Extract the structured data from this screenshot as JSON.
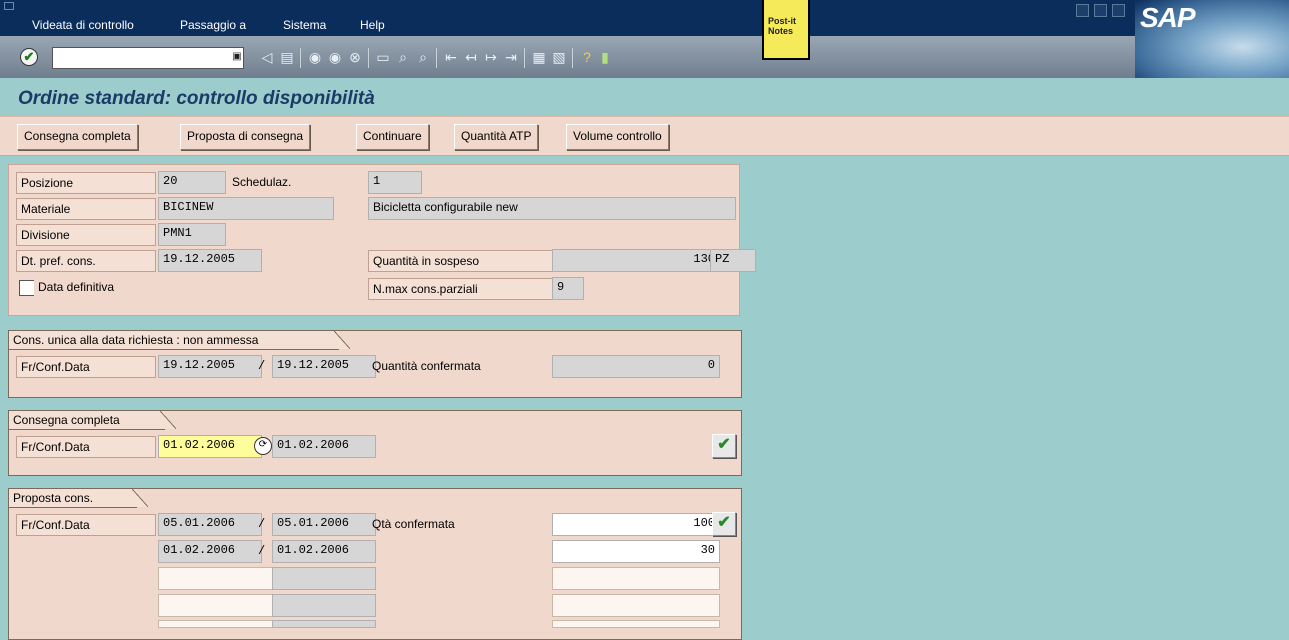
{
  "menu": {
    "items": [
      "Videata di controllo",
      "Passaggio a",
      "Sistema",
      "Help"
    ]
  },
  "branding": {
    "logo": "SAP",
    "postit_label": "Post-it Notes"
  },
  "toolbar": {
    "command_field_value": "",
    "icons": [
      "enter-icon",
      "back-icon",
      "save-icon",
      "green-back-icon",
      "exit-icon",
      "cancel-icon",
      "print-icon",
      "find-icon",
      "find-next-icon",
      "first-page-icon",
      "prev-page-icon",
      "next-page-icon",
      "last-page-icon",
      "create-session-icon",
      "shortcut-icon",
      "help-icon",
      "layout-icon"
    ]
  },
  "page": {
    "title": "Ordine standard: controllo disponibilità"
  },
  "app_toolbar": {
    "buttons": [
      "Consegna completa",
      "Proposta di consegna",
      "Continuare",
      "Quantità ATP",
      "Volume controllo"
    ]
  },
  "header": {
    "posizione_label": "Posizione",
    "posizione_value": "20",
    "schedulaz_label": "Schedulaz.",
    "schedulaz_value": "1",
    "materiale_label": "Materiale",
    "materiale_value": "BICINEW",
    "materiale_desc": "Bicicletta configurabile new",
    "divisione_label": "Divisione",
    "divisione_value": "PMN1",
    "dt_pref_label": "Dt. pref. cons.",
    "dt_pref_value": "19.12.2005",
    "qta_sospeso_label": "Quantità in sospeso",
    "qta_sospeso_value": "130",
    "qta_sospeso_unit": "PZ",
    "data_definitiva_label": "Data definitiva",
    "data_definitiva_checked": false,
    "nmax_label": "N.max cons.parziali",
    "nmax_value": "9"
  },
  "group_unica": {
    "title": "Cons. unica alla data richiesta : non ammessa",
    "row_label": "Fr/Conf.Data",
    "date_from": "19.12.2005",
    "separator": "/",
    "date_to": "19.12.2005",
    "qty_label": "Quantità confermata",
    "qty_value": "0"
  },
  "group_completa": {
    "title": "Consegna completa",
    "row_label": "Fr/Conf.Data",
    "date_from": "01.02.2006",
    "date_to": "01.02.2006"
  },
  "group_proposta": {
    "title": "Proposta cons.",
    "row_label": "Fr/Conf.Data",
    "qty_label": "Qtà confermata",
    "rows": [
      {
        "from": "05.01.2006",
        "sep": "/",
        "to": "05.01.2006",
        "qty": "100"
      },
      {
        "from": "01.02.2006",
        "sep": "/",
        "to": "01.02.2006",
        "qty": "30"
      }
    ]
  }
}
